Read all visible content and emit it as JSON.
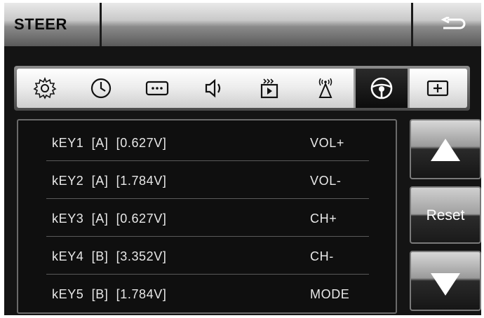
{
  "header": {
    "title": "STEER",
    "back_icon": "back-arrow-icon"
  },
  "tabs": [
    {
      "icon": "gear-icon",
      "active": false
    },
    {
      "icon": "clock-icon",
      "active": false
    },
    {
      "icon": "dots-icon",
      "active": false
    },
    {
      "icon": "speaker-icon",
      "active": false
    },
    {
      "icon": "video-icon",
      "active": false
    },
    {
      "icon": "antenna-icon",
      "active": false
    },
    {
      "icon": "steering-wheel-icon",
      "active": true
    },
    {
      "icon": "plus-icon",
      "active": false
    }
  ],
  "keys": [
    {
      "label": "kEY1  [A]  [0.627V]",
      "function": "VOL+"
    },
    {
      "label": "kEY2  [A]  [1.784V]",
      "function": "VOL-"
    },
    {
      "label": "kEY3  [A]  [0.627V]",
      "function": "CH+"
    },
    {
      "label": "kEY4  [B]  [3.352V]",
      "function": "CH-"
    },
    {
      "label": "kEY5  [B]  [1.784V]",
      "function": "MODE"
    }
  ],
  "side": {
    "reset_label": "Reset",
    "up_icon": "up-triangle-icon",
    "down_icon": "down-triangle-icon"
  }
}
